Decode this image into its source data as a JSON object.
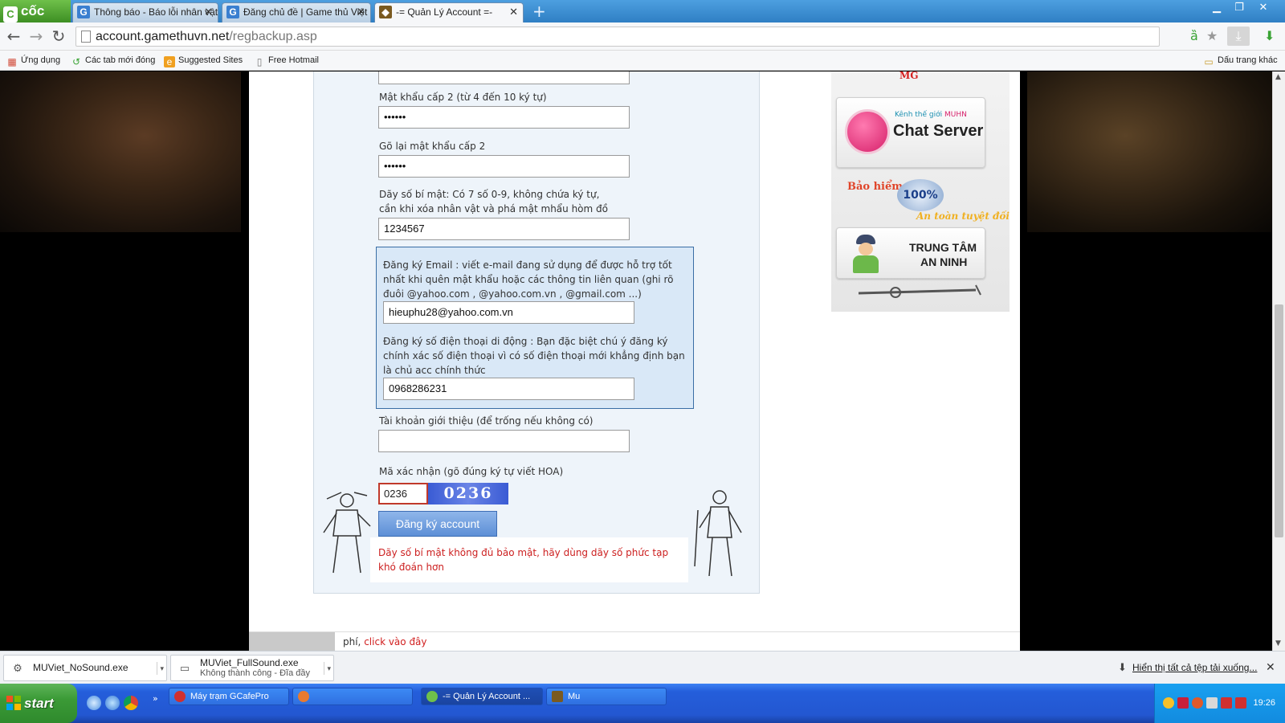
{
  "browser": {
    "brand": "cốc cốc",
    "tabs": [
      {
        "label": "Thông báo - Báo lỗi nhân vật",
        "icon": "G"
      },
      {
        "label": "Đăng chủ đề | Game thủ Việt",
        "icon": "G"
      },
      {
        "label": "-= Quản Lý Account =-",
        "icon": "mu"
      }
    ],
    "new_tab": "+",
    "url_host": "account.gamethuvn.net",
    "url_path": "/regbackup.asp",
    "bookmarks": [
      {
        "label": "Ứng dụng",
        "icon": "apps-icon"
      },
      {
        "label": "Các tab mới đóng",
        "icon": "history-icon"
      },
      {
        "label": "Suggested Sites",
        "icon": "sites-icon"
      },
      {
        "label": "Free Hotmail",
        "icon": "page-icon"
      }
    ],
    "other_bookmarks": "Dấu trang khác"
  },
  "form": {
    "pw2_label": "Mật khẩu cấp 2 (từ 4 đến 10 ký tự)",
    "pw2_value": "••••••",
    "pw2_confirm_label": "Gõ lại mật khẩu cấp 2",
    "pw2_confirm_value": "••••••",
    "secret_label_1": "Dãy số bí mật: Có 7 số 0-9, không chứa ký tự,",
    "secret_label_2": "cần khi xóa nhân vật và phá mật mhẩu hòm đồ",
    "secret_value": "1234567",
    "email_label": "Đăng ký Email : viết e-mail đang sử dụng để được hỗ trợ tốt nhất khi quên mật khẩu hoặc các thông tin liên quan (ghi rõ đuôi @yahoo.com , @yahoo.com.vn , @gmail.com ...)",
    "email_value": "hieuphu28@yahoo.com.vn",
    "phone_label": "Đăng ký số điện thoại di động : Bạn đặc biệt chú ý đăng ký chính xác số điện thoại vì có số điện thoại mới khẳng định bạn là chủ acc chính thức",
    "phone_value": "0968286231",
    "referral_label": "Tài khoản giới thiệu (để trống nếu không có)",
    "referral_value": "",
    "captcha_label": "Mã xác nhận (gõ đúng ký tự viết HOA)",
    "captcha_value": "0236",
    "captcha_image_text": "0236",
    "submit_label": "Đăng ký account",
    "error_message": "Dãy số bí mật không đủ bảo mật, hãy dùng dãy số phức tạp khó đoán hơn"
  },
  "sidebar": {
    "mg_text": "MG",
    "chat_small": "Kênh thế giới",
    "chat_small_accent": "MUHN",
    "chat_title": "Chat Server",
    "insurance_title": "Bảo hiểm đồ",
    "insurance_badge": "100%",
    "insurance_sub": "An toàn tuyệt đối",
    "security_line1": "TRUNG TÂM",
    "security_line2": "AN NINH"
  },
  "footer": {
    "text": "phí,",
    "link": "click vào đây"
  },
  "downloads": [
    {
      "name": "MUViet_NoSound.exe",
      "status": ""
    },
    {
      "name": "MUViet_FullSound.exe",
      "status": "Không thành công - Đĩa đầy"
    }
  ],
  "downloads_show_all": "Hiển thị tất cả tệp tải xuống...",
  "taskbar": {
    "start": "start",
    "tasks": [
      {
        "label": "Máy trạm GCafePro"
      },
      {
        "label": ""
      },
      {
        "label": "-= Quản Lý Account ..."
      },
      {
        "label": "Mu"
      }
    ],
    "clock": "19:26"
  },
  "colors": {
    "accent_blue": "#2f7fc4",
    "error_red": "#cc1f1f",
    "contact_box": "#d9e8f7",
    "xp_start_green": "#3b9a36"
  }
}
